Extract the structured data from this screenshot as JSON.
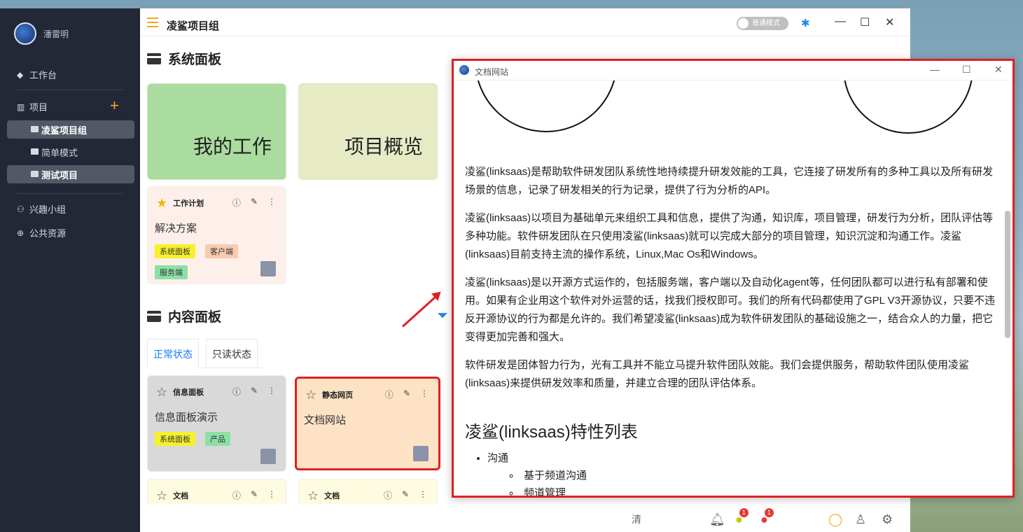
{
  "sidebar": {
    "user_name": "潘雷明",
    "workbench": "工作台",
    "projects_label": "项目",
    "projects": [
      {
        "label": "凌鲨项目组",
        "active": true
      },
      {
        "label": "简单模式",
        "active": false
      },
      {
        "label": "测试项目",
        "active": true
      }
    ],
    "interest_group": "兴趣小组",
    "public_resources": "公共资源"
  },
  "topbar": {
    "title": "凌鲨项目组",
    "mode_toggle": "普通模式"
  },
  "system_panel": {
    "title": "系统面板",
    "tiles": [
      {
        "label": "我的工作",
        "color": "#a9dc9e"
      },
      {
        "label": "项目概览",
        "color": "#e6ebc6"
      }
    ],
    "plan_card": {
      "type_label": "工作计划",
      "title": "解决方案",
      "tags": [
        {
          "label": "系统面板",
          "color": "#f7f12a"
        },
        {
          "label": "客户端",
          "color": "#f8cbb0"
        },
        {
          "label": "服务端",
          "color": "#8ce0a6"
        }
      ]
    }
  },
  "content_panel": {
    "title": "内容面板",
    "tabs": [
      {
        "label": "正常状态",
        "active": true
      },
      {
        "label": "只读状态",
        "active": false
      }
    ],
    "cards": [
      {
        "type_label": "信息面板",
        "title": "信息面板演示",
        "tags": [
          {
            "label": "系统面板",
            "color": "#f7f12a"
          },
          {
            "label": "产品",
            "color": "#8ce0a6"
          }
        ],
        "color": "#d9d9d9"
      },
      {
        "type_label": "静态网页",
        "title": "文档网站",
        "tags": [],
        "color": "#fde2c5"
      },
      {
        "type_label": "文档",
        "title": "",
        "tags": [],
        "color": "#fdfbe0"
      },
      {
        "type_label": "文档",
        "title": "",
        "tags": [],
        "color": "#fdfbe0"
      }
    ]
  },
  "status_bar": {
    "text": "清",
    "badge_1": "1",
    "badge_2": "1"
  },
  "doc_window": {
    "title": "文档网站",
    "paragraphs": [
      "凌鲨(linksaas)是帮助软件研发团队系统性地持续提升研发效能的工具，它连接了研发所有的多种工具以及所有研发场景的信息，记录了研发相关的行为记录，提供了行为分析的API。",
      "凌鲨(linksaas)以项目为基础单元来组织工具和信息，提供了沟通，知识库，项目管理，研发行为分析，团队评估等多种功能。软件研发团队在只使用凌鲨(linksaas)就可以完成大部分的项目管理，知识沉淀和沟通工作。凌鲨(linksaas)目前支持主流的操作系统，Linux,Mac Os和Windows。",
      "凌鲨(linksaas)是以开源方式运作的，包括服务端，客户端以及自动化agent等，任何团队都可以进行私有部署和使用。如果有企业用这个软件对外运营的话，找我们授权即可。我们的所有代码都使用了GPL V3开源协议，只要不违反开源协议的行为都是允许的。我们希望凌鲨(linksaas)成为软件研发团队的基础设施之一，结合众人的力量，把它变得更加完善和强大。",
      "软件研发是团体智力行为，光有工具并不能立马提升软件团队效能。我们会提供服务，帮助软件团队使用凌鲨(linksaas)来提供研发效率和质量，并建立合理的团队评估体系。"
    ],
    "heading": "凌鲨(linksaas)特性列表",
    "list": {
      "item": "沟通",
      "subitems": [
        "基于频道沟通",
        "频道管理"
      ]
    }
  }
}
